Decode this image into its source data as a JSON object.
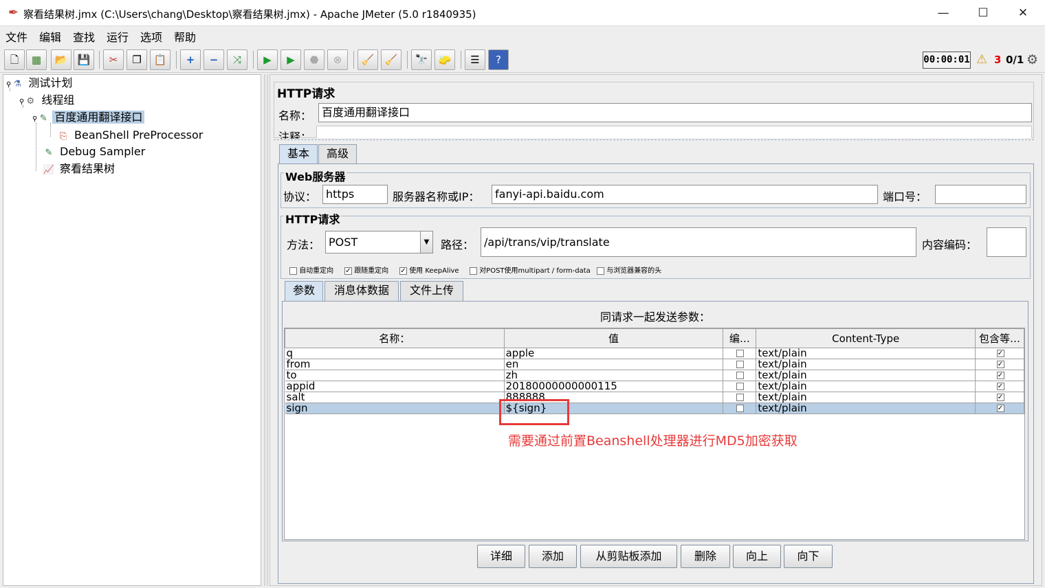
{
  "window": {
    "title": "察看结果树.jmx (C:\\Users\\chang\\Desktop\\察看结果树.jmx) - Apache JMeter (5.0 r1840935)",
    "minimize": "—",
    "maximize": "☐",
    "close": "✕"
  },
  "menu": [
    "文件",
    "编辑",
    "查找",
    "运行",
    "选项",
    "帮助"
  ],
  "toolbar": {
    "timer": "00:00:01",
    "warn_count": "3",
    "thread_count": "0/1"
  },
  "tree": [
    {
      "label": "测试计划",
      "icon": "test-plan-icon"
    },
    {
      "label": "线程组",
      "icon": "gear-icon"
    },
    {
      "label": "百度通用翻译接口",
      "icon": "pipette-icon"
    },
    {
      "label": "BeanShell PreProcessor",
      "icon": "preprocessor-icon"
    },
    {
      "label": "Debug Sampler",
      "icon": "pipette-icon"
    },
    {
      "label": "察看结果树",
      "icon": "chart-icon"
    }
  ],
  "panel": {
    "title": "HTTP请求",
    "name_label": "名称：",
    "name_value": "百度通用翻译接口",
    "comment_label": "注释：",
    "tabs": [
      "基本",
      "高级"
    ],
    "web_server": {
      "legend": "Web服务器",
      "protocol_label": "协议：",
      "protocol": "https",
      "server_label": "服务器名称或IP：",
      "server": "fanyi-api.baidu.com",
      "port_label": "端口号：",
      "port": ""
    },
    "http": {
      "legend": "HTTP请求",
      "method_label": "方法：",
      "method": "POST",
      "path_label": "路径：",
      "path": "/api/trans/vip/translate",
      "encoding_label": "内容编码：",
      "encoding": ""
    },
    "checkboxes": [
      {
        "label": "自动重定向",
        "checked": false
      },
      {
        "label": "跟随重定向",
        "checked": true
      },
      {
        "label": "使用 KeepAlive",
        "checked": true
      },
      {
        "label": "对POST使用multipart / form-data",
        "checked": false
      },
      {
        "label": "与浏览器兼容的头",
        "checked": false
      }
    ],
    "subtabs": [
      "参数",
      "消息体数据",
      "文件上传"
    ],
    "params_title": "同请求一起发送参数：",
    "columns": [
      "名称：",
      "值",
      "编…",
      "Content-Type",
      "包含等…"
    ],
    "rows": [
      {
        "name": "q",
        "value": "apple",
        "enc": false,
        "type": "text/plain",
        "inc": true
      },
      {
        "name": "from",
        "value": "en",
        "enc": false,
        "type": "text/plain",
        "inc": true
      },
      {
        "name": "to",
        "value": "zh",
        "enc": false,
        "type": "text/plain",
        "inc": true
      },
      {
        "name": "appid",
        "value": "20180000000000115",
        "enc": false,
        "type": "text/plain",
        "inc": true
      },
      {
        "name": "salt",
        "value": "888888",
        "enc": false,
        "type": "text/plain",
        "inc": true
      },
      {
        "name": "sign",
        "value": "${sign}",
        "enc": false,
        "type": "text/plain",
        "inc": true
      }
    ],
    "buttons": [
      "详细",
      "添加",
      "从剪贴板添加",
      "删除",
      "向上",
      "向下"
    ]
  },
  "annotation": "需要通过前置Beanshell处理器进行MD5加密获取",
  "colors": {
    "accent_red": "#e83a3a",
    "selection": "#b8cfe5"
  }
}
